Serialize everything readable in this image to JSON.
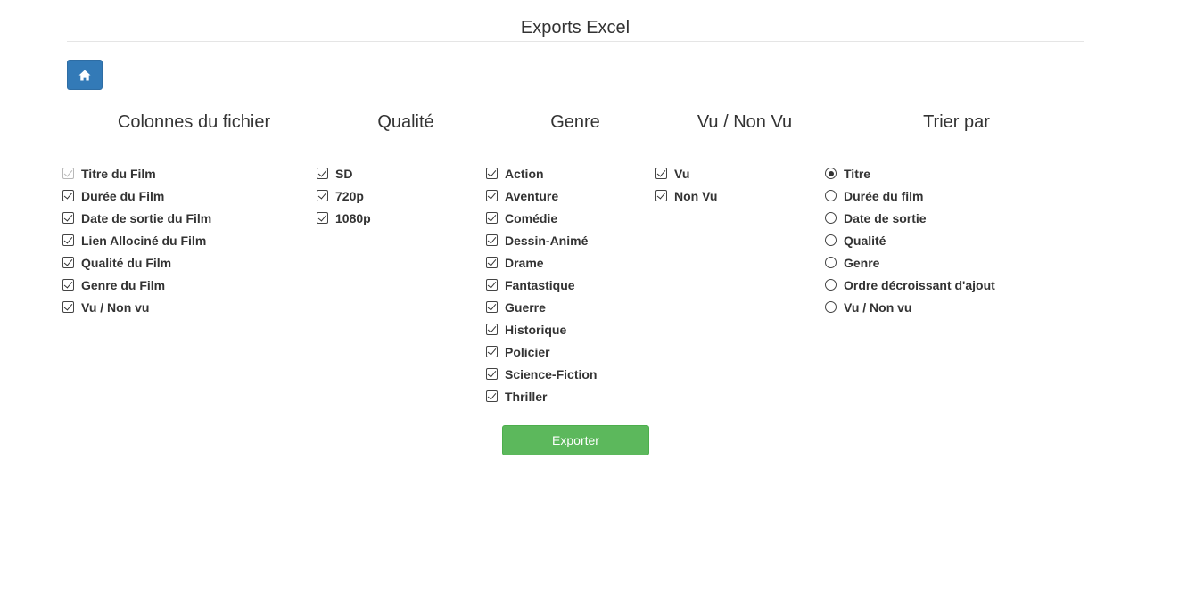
{
  "page": {
    "title": "Exports Excel"
  },
  "home_button": {
    "icon": "home-icon",
    "color": "#337ab7"
  },
  "columns": {
    "header": "Colonnes du fichier",
    "items": [
      {
        "label": "Titre du Film",
        "checked": true,
        "disabled": true
      },
      {
        "label": "Durée du Film",
        "checked": true
      },
      {
        "label": "Date de sortie du Film",
        "checked": true
      },
      {
        "label": "Lien Allociné du Film",
        "checked": true
      },
      {
        "label": "Qualité du Film",
        "checked": true
      },
      {
        "label": "Genre du Film",
        "checked": true
      },
      {
        "label": "Vu / Non vu",
        "checked": true
      }
    ]
  },
  "quality": {
    "header": "Qualité",
    "items": [
      {
        "label": "SD",
        "checked": true
      },
      {
        "label": "720p",
        "checked": true
      },
      {
        "label": "1080p",
        "checked": true
      }
    ]
  },
  "genre": {
    "header": "Genre",
    "items": [
      {
        "label": "Action",
        "checked": true
      },
      {
        "label": "Aventure",
        "checked": true
      },
      {
        "label": "Comédie",
        "checked": true
      },
      {
        "label": "Dessin-Animé",
        "checked": true
      },
      {
        "label": "Drame",
        "checked": true
      },
      {
        "label": "Fantastique",
        "checked": true
      },
      {
        "label": "Guerre",
        "checked": true
      },
      {
        "label": "Historique",
        "checked": true
      },
      {
        "label": "Policier",
        "checked": true
      },
      {
        "label": "Science-Fiction",
        "checked": true
      },
      {
        "label": "Thriller",
        "checked": true
      }
    ]
  },
  "seen": {
    "header": "Vu / Non Vu",
    "items": [
      {
        "label": "Vu",
        "checked": true
      },
      {
        "label": "Non Vu",
        "checked": true
      }
    ]
  },
  "sort": {
    "header": "Trier par",
    "items": [
      {
        "label": "Titre",
        "checked": true
      },
      {
        "label": "Durée du film",
        "checked": false
      },
      {
        "label": "Date de sortie",
        "checked": false
      },
      {
        "label": "Qualité",
        "checked": false
      },
      {
        "label": "Genre",
        "checked": false
      },
      {
        "label": "Ordre décroissant d'ajout",
        "checked": false
      },
      {
        "label": "Vu / Non vu",
        "checked": false
      }
    ]
  },
  "export_button": {
    "label": "Exporter",
    "color": "#5cb85c"
  }
}
